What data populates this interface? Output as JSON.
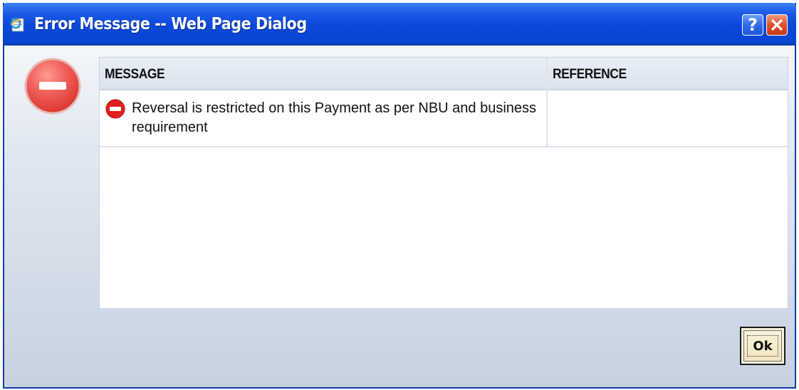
{
  "window": {
    "title": "Error Message -- Web Page Dialog",
    "help_label": "?",
    "close_icon": "close-icon"
  },
  "dialog": {
    "icon": "error-stop-icon",
    "columns": {
      "message": "MESSAGE",
      "reference": "REFERENCE"
    },
    "rows": [
      {
        "icon": "error-small-icon",
        "message": "Reversal is restricted on this Payment as per NBU and business requirement",
        "reference": ""
      }
    ],
    "ok_label": "Ok"
  },
  "colors": {
    "titlebar": "#0a48d8",
    "error_red": "#e0403a",
    "close_button": "#e0502a"
  }
}
